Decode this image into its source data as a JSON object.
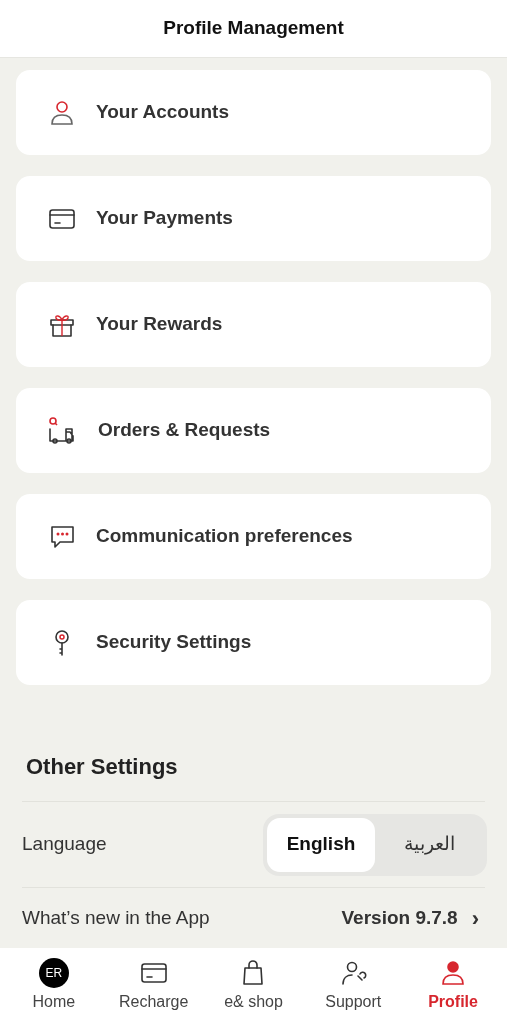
{
  "header": {
    "title": "Profile Management"
  },
  "menu_items": [
    {
      "kind": "person",
      "label": "Your Accounts"
    },
    {
      "kind": "card",
      "label": "Your Payments"
    },
    {
      "kind": "gift",
      "label": "Your Rewards"
    },
    {
      "kind": "truck",
      "label": "Orders & Requests"
    },
    {
      "kind": "chat",
      "label": "Communication preferences"
    },
    {
      "kind": "key",
      "label": "Security Settings"
    }
  ],
  "other_settings": {
    "title": "Other Settings",
    "language": {
      "label": "Language",
      "options": [
        {
          "label": "English",
          "selected": true
        },
        {
          "label": "العربية",
          "selected": false
        }
      ]
    },
    "whats_new": {
      "label": "What’s new in the App",
      "value": "Version 9.7.8",
      "chevron": "›"
    }
  },
  "bottom_nav": [
    {
      "kind": "avatar",
      "avatar_text": "ER",
      "label": "Home",
      "selected": false
    },
    {
      "kind": "card",
      "label": "Recharge",
      "selected": false
    },
    {
      "kind": "bag",
      "label": "e& shop",
      "selected": false
    },
    {
      "kind": "support",
      "label": "Support",
      "selected": false
    },
    {
      "kind": "person",
      "label": "Profile",
      "selected": true
    }
  ]
}
